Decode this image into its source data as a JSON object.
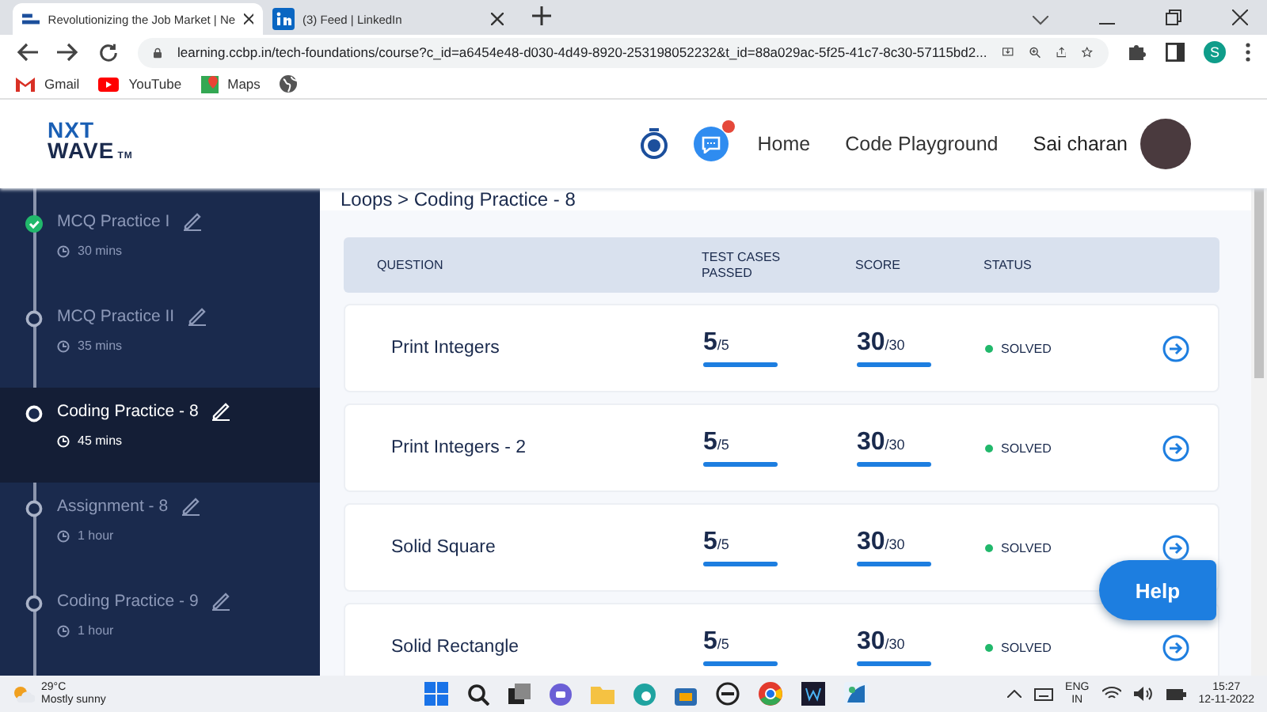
{
  "browser": {
    "tabs": [
      {
        "title": "Revolutionizing the Job Market | Ne",
        "selected": true
      },
      {
        "title": "(3) Feed | LinkedIn",
        "selected": false
      }
    ],
    "url": "learning.ccbp.in/tech-foundations/course?c_id=a6454e48-d030-4d49-8920-253198052232&t_id=88a029ac-5f25-41c7-8c30-57115bd2...",
    "profile_initial": "S",
    "bookmarks": [
      {
        "label": "Gmail"
      },
      {
        "label": "YouTube"
      },
      {
        "label": "Maps"
      }
    ]
  },
  "header": {
    "logo_top": "NXT",
    "logo_bottom": "WAVE",
    "logo_mark": "TM",
    "nav": [
      "Home",
      "Code Playground"
    ],
    "user": "Sai charan",
    "notification": true
  },
  "sidebar": {
    "items": [
      {
        "title": "MCQ Practice I",
        "duration": "30 mins",
        "completed": true,
        "selected": false
      },
      {
        "title": "MCQ Practice II",
        "duration": "35 mins",
        "completed": false,
        "selected": false
      },
      {
        "title": "Coding Practice - 8",
        "duration": "45 mins",
        "completed": false,
        "selected": true
      },
      {
        "title": "Assignment - 8",
        "duration": "1 hour",
        "completed": false,
        "selected": false
      },
      {
        "title": "Coding Practice - 9",
        "duration": "1 hour",
        "completed": false,
        "selected": false
      }
    ]
  },
  "breadcrumb": "Loops > Coding Practice - 8",
  "table": {
    "columns": [
      "QUESTION",
      "TEST CASES PASSED",
      "SCORE",
      "STATUS"
    ],
    "rows": [
      {
        "question": "Print Integers",
        "tests": {
          "passed": "5",
          "total": "/5"
        },
        "score": {
          "value": "30",
          "max": "/30"
        },
        "status": "SOLVED",
        "solved": true
      },
      {
        "question": "Print Integers - 2",
        "tests": {
          "passed": "5",
          "total": "/5"
        },
        "score": {
          "value": "30",
          "max": "/30"
        },
        "status": "SOLVED",
        "solved": true
      },
      {
        "question": "Solid Square",
        "tests": {
          "passed": "5",
          "total": "/5"
        },
        "score": {
          "value": "30",
          "max": "/30"
        },
        "status": "SOLVED",
        "solved": true
      },
      {
        "question": "Solid Rectangle",
        "tests": {
          "passed": "5",
          "total": "/5"
        },
        "score": {
          "value": "30",
          "max": "/30"
        },
        "status": "SOLVED",
        "solved": true
      }
    ]
  },
  "help_button": "Help",
  "taskbar": {
    "temperature": "29°C",
    "weather": "Mostly sunny",
    "language": "ENG",
    "region": "IN",
    "time": "15:27",
    "date": "12-11-2022"
  }
}
